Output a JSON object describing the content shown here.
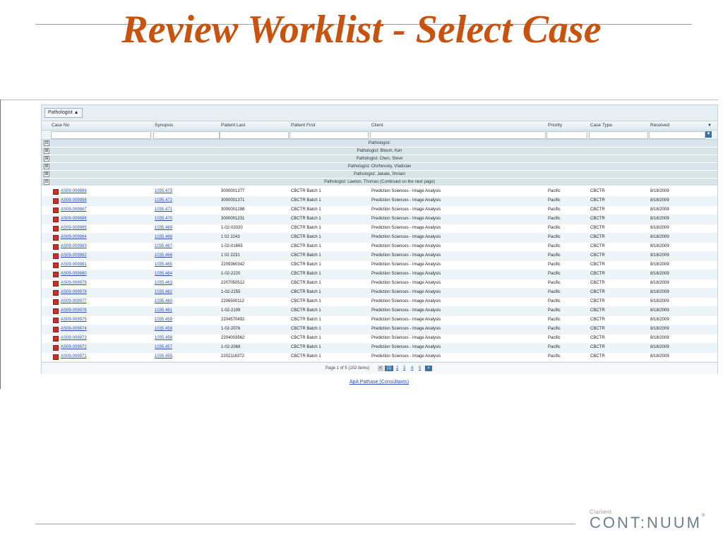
{
  "slide": {
    "title": "Review Worklist - Select Case"
  },
  "group_bar": {
    "chip_label": "Pathologist",
    "chip_icon": "sort-asc-icon"
  },
  "columns": [
    "Case No",
    "Synopsis",
    "Patient Last",
    "Patient First",
    "Client",
    "Priority",
    "Case Type",
    "Received"
  ],
  "groups": [
    {
      "label": "Pathologist:",
      "expander": "⊟"
    },
    {
      "label": "Pathologist: Bloom, Ken",
      "expander": "⊞"
    },
    {
      "label": "Pathologist: Chen, Steve",
      "expander": "⊞"
    },
    {
      "label": "Pathologist: Chirhevsky, Vladislav",
      "expander": "⊞"
    },
    {
      "label": "Pathologist: Jakate, Shriam",
      "expander": "⊞"
    },
    {
      "label": "Pathologist: Lawton, Thomas (Continued on the next page)",
      "expander": "⊟"
    }
  ],
  "rows": [
    [
      "AS09-009989",
      "1035.473",
      "3000001377",
      "CBCTR Batch 1",
      "Prediction Sciences - Image Analysis",
      "Pacific",
      "CBCTR",
      "8/18/2009"
    ],
    [
      "AS09-009988",
      "1035.472",
      "3000001371",
      "CBCTR Batch 1",
      "Prediction Sciences - Image Analysis",
      "Pacific",
      "CBCTR",
      "8/18/2009"
    ],
    [
      "AS09-009987",
      "1035.471",
      "3000001288",
      "CBCTR Batch 1",
      "Prediction Sciences - Image Analysis",
      "Pacific",
      "CBCTR",
      "8/18/2009"
    ],
    [
      "AS09-009986",
      "1035.470",
      "3000001231",
      "CBCTR Batch 1",
      "Prediction Sciences - Image Analysis",
      "Pacific",
      "CBCTR",
      "8/18/2009"
    ],
    [
      "AS09-009985",
      "1035.469",
      "1-02-02020",
      "CBCTR Batch 1",
      "Prediction Sciences - Image Analysis",
      "Pacific",
      "CBCTR",
      "8/18/2009"
    ],
    [
      "AS09-009984",
      "1035.468",
      "1 02 2243",
      "CBCTR Batch 1",
      "Prediction Sciences - Image Analysis",
      "Pacific",
      "CBCTR",
      "8/18/2009"
    ],
    [
      "AS09-009983",
      "1035.467",
      "1-02-01665",
      "CBCTR Batch 1",
      "Prediction Sciences - Image Analysis",
      "Pacific",
      "CBCTR",
      "8/18/2009"
    ],
    [
      "AS09-009982",
      "1035.466",
      "1 02 2231",
      "CBCTR Batch 1",
      "Prediction Sciences - Image Analysis",
      "Pacific",
      "CBCTR",
      "8/18/2009"
    ],
    [
      "AS09-009981",
      "1035.465",
      "2209360342",
      "CBCTR Batch 1",
      "Prediction Sciences - Image Analysis",
      "Pacific",
      "CBCTR",
      "8/18/2009"
    ],
    [
      "AS09-009980",
      "1035.464",
      "1-02-2220",
      "CBCTR Batch 1",
      "Prediction Sciences - Image Analysis",
      "Pacific",
      "CBCTR",
      "8/18/2009"
    ],
    [
      "AS09-009979",
      "1035.463",
      "2207050512",
      "CBCTR Batch 1",
      "Prediction Sciences - Image Analysis",
      "Pacific",
      "CBCTR",
      "8/18/2009"
    ],
    [
      "AS09-009978",
      "1035.462",
      "1-02-2155",
      "CBCTR Batch 1",
      "Prediction Sciences - Image Analysis",
      "Pacific",
      "CBCTR",
      "8/18/2009"
    ],
    [
      "AS09-009977",
      "1035.460",
      "2206500112",
      "CBCTR Batch 1",
      "Prediction Sciences - Image Analysis",
      "Pacific",
      "CBCTR",
      "8/18/2009"
    ],
    [
      "AS09-009976",
      "1035.461",
      "1-02-2109",
      "CBCTR Batch 1",
      "Prediction Sciences - Image Analysis",
      "Pacific",
      "CBCTR",
      "8/18/2009"
    ],
    [
      "AS09-009975",
      "1035.459",
      "2204570492",
      "CBCTR Batch 1",
      "Prediction Sciences - Image Analysis",
      "Pacific",
      "CBCTR",
      "8/18/2009"
    ],
    [
      "AS09-009974",
      "1035.458",
      "1-02-2076",
      "CBCTR Batch 1",
      "Prediction Sciences - Image Analysis",
      "Pacific",
      "CBCTR",
      "8/18/2009"
    ],
    [
      "AS09-009973",
      "1035.456",
      "2204003562",
      "CBCTR Batch 1",
      "Prediction Sciences - Image Analysis",
      "Pacific",
      "CBCTR",
      "8/18/2009"
    ],
    [
      "AS09-009972",
      "1035.457",
      "1-02-2068",
      "CBCTR Batch 1",
      "Prediction Sciences - Image Analysis",
      "Pacific",
      "CBCTR",
      "8/18/2009"
    ],
    [
      "AS09-009971",
      "1035.455",
      "2202116372",
      "CBCTR Batch 1",
      "Prediction Sciences - Image Analysis",
      "Pacific",
      "CBCTR",
      "8/18/2009"
    ]
  ],
  "pager": {
    "info": "Page 1 of 5 (102 items)",
    "prev": "<",
    "current": "[1]",
    "pages": [
      "2",
      "3",
      "4",
      "5"
    ],
    "next": ">"
  },
  "footer": {
    "link": "ApA Pathase (Consultants)"
  },
  "logo": {
    "small": "Clarient",
    "main": "CONT:NUUM",
    "tm": "®"
  },
  "colors": {
    "title": "#c8530f",
    "link": "#2a4fb3",
    "header_bg": "#dfeaef",
    "alt_row": "#edf5f9",
    "group_row": "#d9e4ea",
    "accent": "#3f6fa0"
  }
}
